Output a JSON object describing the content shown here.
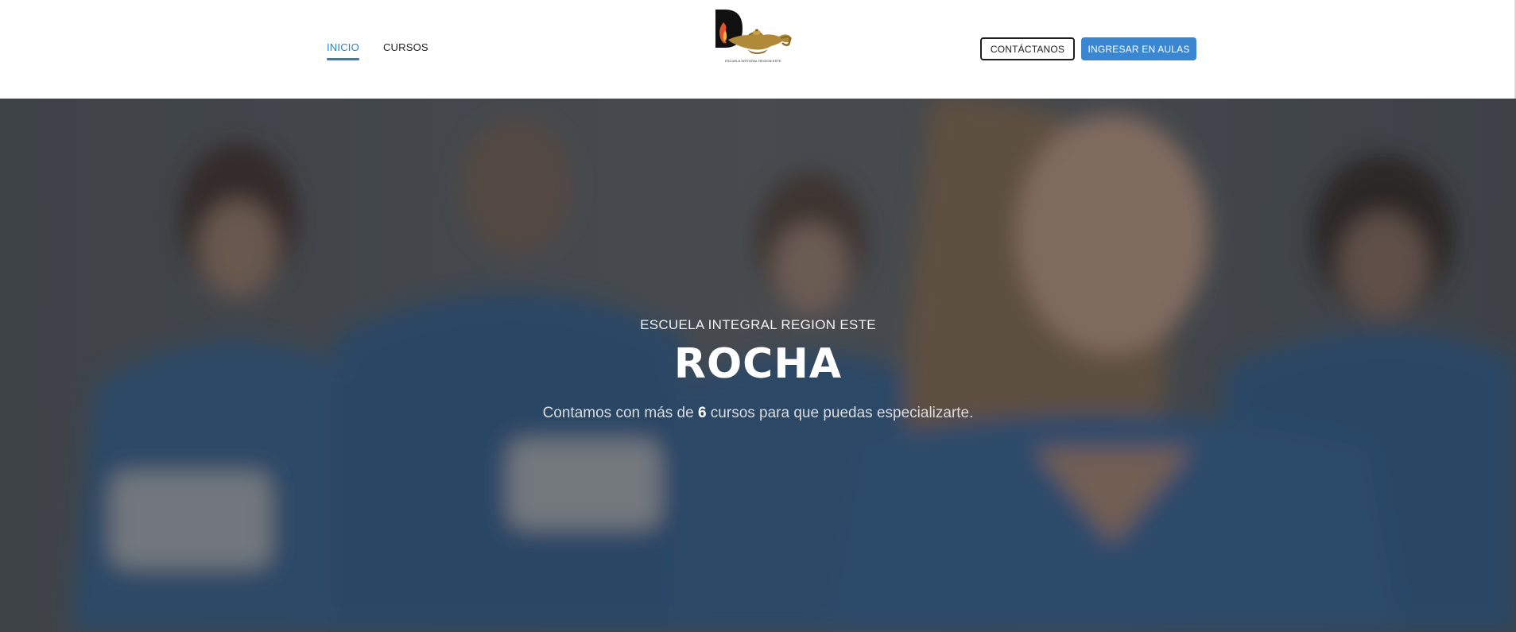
{
  "header": {
    "nav": [
      {
        "label": "INICIO",
        "active": true
      },
      {
        "label": "CURSOS",
        "active": false
      }
    ],
    "logo": {
      "tagline": "ESCUELA INTEGRAL REGION ESTE",
      "icon": "oil-lamp-logo-icon"
    },
    "buttons": {
      "contact_label": "CONTÁCTANOS",
      "login_label": "INGRESAR EN AULAS"
    }
  },
  "hero": {
    "eyebrow": "ESCUELA INTEGRAL REGION ESTE",
    "title": "ROCHA",
    "subtitle_prefix": "Contamos con más de ",
    "subtitle_number": "6",
    "subtitle_suffix": " cursos para que puedas especializarte.",
    "background": "blurred-photo-of-smiling-nurses-in-blue-scrubs"
  },
  "colors": {
    "accent": "#3a86d1",
    "active_nav": "#2f7fc8",
    "hero_overlay": "#33393f",
    "scrubs": "#2d5a85"
  }
}
